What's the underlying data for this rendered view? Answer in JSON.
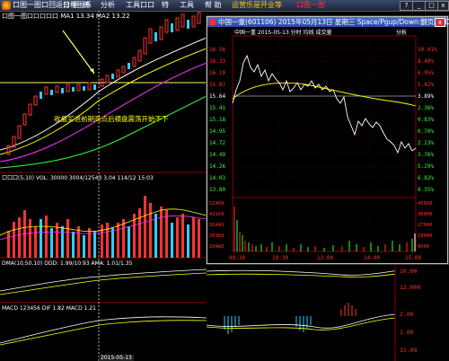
{
  "menubar": {
    "items": [
      "口图一图口回返口程图系",
      "分 析",
      "统",
      "分析",
      "工具口口",
      "特",
      "工具",
      "帮 助"
    ],
    "center_text": "运营乐是开业等",
    "center_text2": "口图一图",
    "buttons": [
      "?",
      "_",
      "□",
      "x"
    ]
  },
  "main_chart": {
    "indicator_header": "口图一图口口口口口 MA1  13.34 MA2 13.22",
    "volume_header": "口口口(5,10) VOL: 30000 3004/12543  3.04 114/12 15:03",
    "macd_header": "DMA(10,50,10) DDD: 1.99/10.93  AMA: 1.01/1.35",
    "kdj_header": "MACD 123456  DIF 1.82  MACD 1.21",
    "annotation": "收盘买进前期高点后横盘震荡开始不下",
    "colors": {
      "up": "#ff3333",
      "down": "#33ccff",
      "ma1": "#ffffff",
      "ma2": "#ffff00",
      "ma3": "#ff33ff",
      "ma4": "#33ff33"
    }
  },
  "popup": {
    "title": "中国一重(601106)  2015年05月13日  星期三   Space/Pgup/Down:翻页/ESC:退出",
    "close": "x",
    "subheader": "中国一重  2015-05-13 分时 均线 成交量",
    "sub_right": "分析",
    "price_labels": [
      "16.56",
      "16.33",
      "16.10",
      "15.87",
      "15.64",
      "15.41",
      "15.18",
      "14.95",
      "14.72",
      "14.49",
      "14.26",
      "14.03",
      "13.80"
    ],
    "pct_labels": [
      "10.01%",
      "8.48%",
      "6.95%",
      "5.42%",
      "3.89%",
      "2.36%",
      "0.83%",
      "0.70%",
      "2.23%",
      "3.76%",
      "5.29%",
      "6.82%",
      "8.35%"
    ],
    "vol_labels": [
      "52400",
      "41920",
      "31440",
      "20960",
      "10480",
      "4480"
    ],
    "vol_labels_right": [
      "45000",
      "36000",
      "27000",
      "18000",
      "9000",
      "4000"
    ],
    "time_labels": [
      "09:30",
      "10:30",
      "13:00",
      "14:00",
      "15:00"
    ]
  },
  "bottom": {
    "right_labels": [
      "10.00",
      "12.000",
      "2.00",
      "1.00",
      "15.00"
    ],
    "date_label": "2015-05-13"
  }
}
